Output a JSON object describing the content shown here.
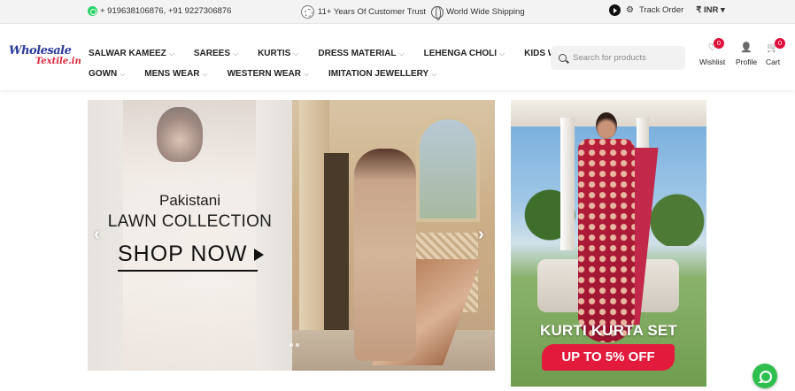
{
  "topbar": {
    "phones": "+ 919638106876, +91 9227306876",
    "trust": "11+ Years Of Customer Trust",
    "shipping": "World Wide Shipping",
    "track_order": "Track Order",
    "currency": "₹ INR",
    "currency_caret": "▾"
  },
  "logo": {
    "line1": "Wholesale",
    "line2": "Textile.in"
  },
  "nav": {
    "row1": [
      {
        "label": "SALWAR KAMEEZ"
      },
      {
        "label": "SAREES"
      },
      {
        "label": "KURTIS"
      },
      {
        "label": "DRESS MATERIAL"
      },
      {
        "label": "LEHENGA CHOLI"
      },
      {
        "label": "KIDS WEAR"
      }
    ],
    "row2": [
      {
        "label": "GOWN"
      },
      {
        "label": "MENS WEAR"
      },
      {
        "label": "WESTERN WEAR"
      },
      {
        "label": "IMITATION JEWELLERY"
      }
    ],
    "chevron": "⌵"
  },
  "search": {
    "placeholder": "Search for products"
  },
  "header_icons": {
    "wishlist": {
      "label": "Wishlist",
      "count": "0",
      "glyph": "♡"
    },
    "profile": {
      "label": "Profile",
      "glyph": "👤"
    },
    "cart": {
      "label": "Cart",
      "count": "0",
      "glyph": "🛒"
    }
  },
  "hero": {
    "line1": "Pakistani",
    "line2": "LAWN COLLECTION",
    "cta": "SHOP NOW",
    "prev": "‹",
    "next": "›"
  },
  "promo": {
    "title": "KURTI KURTA SET",
    "offer": "UP TO 5% OFF"
  },
  "colors": {
    "accent": "#e21b3c",
    "brand_blue": "#2a3a9c",
    "whatsapp": "#25d366"
  }
}
